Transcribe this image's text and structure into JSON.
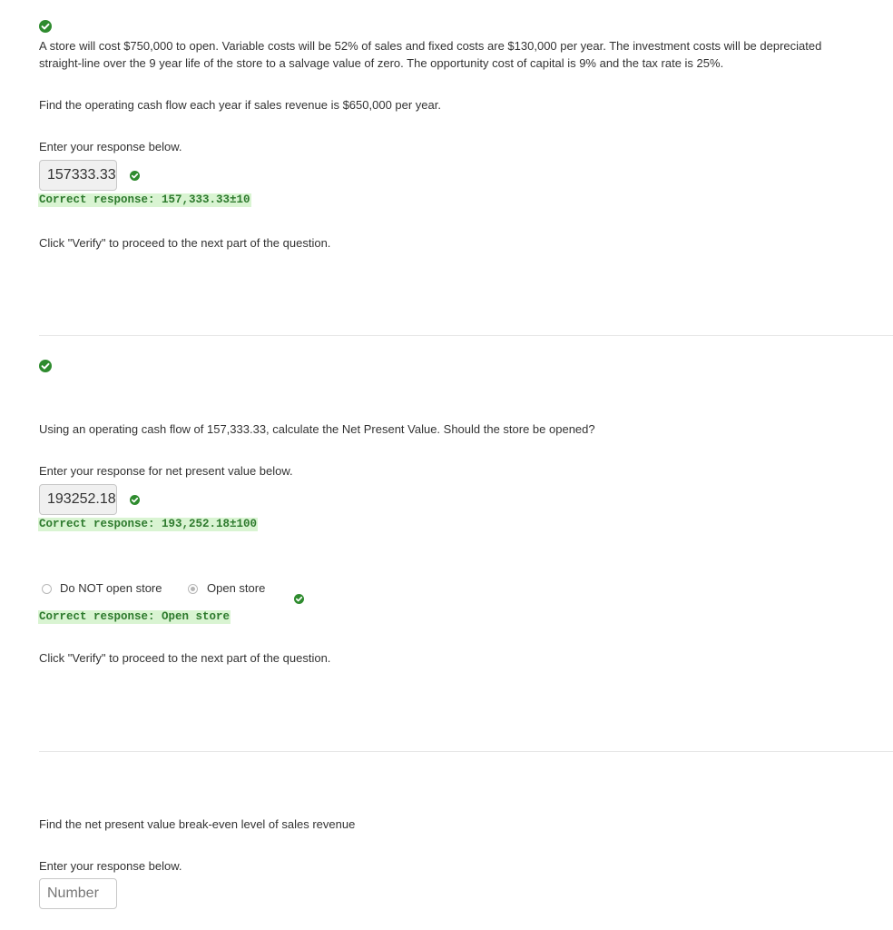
{
  "part1": {
    "problem_line1": "A store will cost $750,000 to open. Variable costs will be 52% of sales and fixed costs are $130,000 per year. The investment costs will be depreciated",
    "problem_line2": "straight-line over the 9 year life of the store to a salvage value of zero. The opportunity cost of capital is 9% and the tax rate is 25%.",
    "question": "Find the operating cash flow each year if sales revenue is $650,000 per year.",
    "prompt": "Enter your response below.",
    "answer_value": "157333.33",
    "correct_response": "Correct response: 157,333.33±10",
    "verify_instruction": "Click \"Verify\" to proceed to the next part of the question."
  },
  "part2": {
    "question": "Using an operating cash flow of 157,333.33, calculate the Net Present Value. Should the store be opened?",
    "prompt": "Enter your response for net present value below.",
    "answer_value": "193252.18",
    "correct_response": "Correct response: 193,252.18±100",
    "radio_options": [
      {
        "label": "Do NOT open store",
        "selected": false
      },
      {
        "label": "Open store",
        "selected": true
      }
    ],
    "choice_correct_response": "Correct response: Open store",
    "verify_instruction": "Click \"Verify\" to proceed to the next part of the question."
  },
  "part3": {
    "question": "Find the net present value break-even level of sales revenue",
    "prompt": "Enter your response below.",
    "input_placeholder": "Number"
  },
  "colors": {
    "check_green": "#2e8b2e",
    "correct_bg": "#d9f4d2",
    "correct_text": "#2d7a2d"
  }
}
